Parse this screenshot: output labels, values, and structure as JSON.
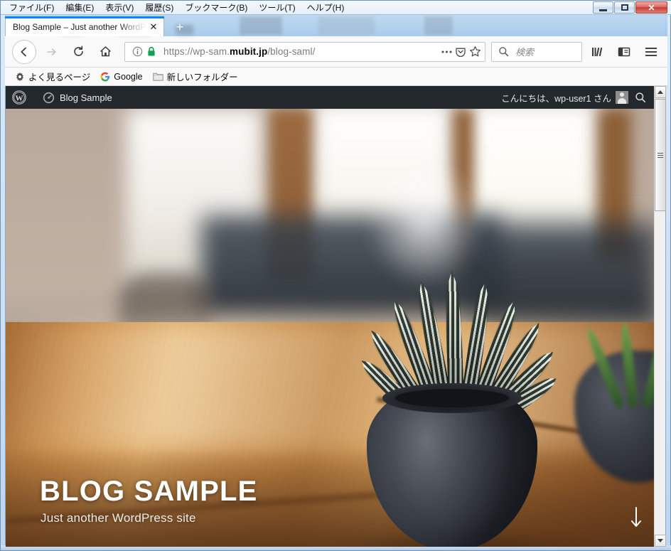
{
  "browser": {
    "menubar": [
      {
        "label": "ファイル(F)",
        "accel": "F"
      },
      {
        "label": "編集(E)",
        "accel": "E"
      },
      {
        "label": "表示(V)",
        "accel": "V"
      },
      {
        "label": "履歴(S)",
        "accel": "S"
      },
      {
        "label": "ブックマーク(B)",
        "accel": "B"
      },
      {
        "label": "ツール(T)",
        "accel": "T"
      },
      {
        "label": "ヘルプ(H)",
        "accel": "H"
      }
    ],
    "window_controls": {
      "minimize": "–",
      "restore": "□",
      "close": "✕"
    },
    "tab": {
      "title": "Blog Sample – Just another WordPress site",
      "close_label": "✕",
      "new_tab_label": "+"
    },
    "nav": {
      "back_label": "←",
      "forward_label": "→",
      "reload_label": "↻",
      "home_label": "⌂"
    },
    "urlbar": {
      "scheme": "https://wp-sam.",
      "domain": "mubit.jp",
      "path": "/blog-saml/",
      "full_url": "https://wp-sam.mubit.jp/blog-saml/",
      "page_info_icon": "info-circle-icon",
      "lock_icon": "padlock-icon",
      "lock_color": "#12a150",
      "page_actions_label": "•••",
      "reader_icon": "pocket-icon",
      "bookmark_icon": "star-icon"
    },
    "search": {
      "placeholder": "検索",
      "icon": "search-icon"
    },
    "toolbar_right": {
      "library_icon": "library-icon",
      "sidebar_icon": "sidebar-icon",
      "menu_icon": "hamburger-menu-icon"
    },
    "bookmarks": [
      {
        "label": "よく見るページ",
        "icon": "gear-icon"
      },
      {
        "label": "Google",
        "icon": "google-g-icon"
      },
      {
        "label": "新しいフォルダー",
        "icon": "folder-icon"
      }
    ]
  },
  "wordpress": {
    "adminbar": {
      "wp_logo_icon": "wordpress-logo-icon",
      "site_icon": "dashboard-speedometer-icon",
      "site_name": "Blog Sample",
      "greeting": "こんにちは、wp-user1 さん",
      "user_name": "wp-user1",
      "avatar_icon": "user-avatar-icon",
      "search_icon": "search-icon",
      "background_color": "#23282d"
    },
    "hero": {
      "title": "BLOG SAMPLE",
      "subtitle": "Just another WordPress site",
      "scroll_indicator_icon": "arrow-down-icon"
    }
  },
  "scrollbar": {
    "up_arrow": "scroll-up-arrow-icon",
    "down_arrow": "scroll-down-arrow-icon"
  }
}
